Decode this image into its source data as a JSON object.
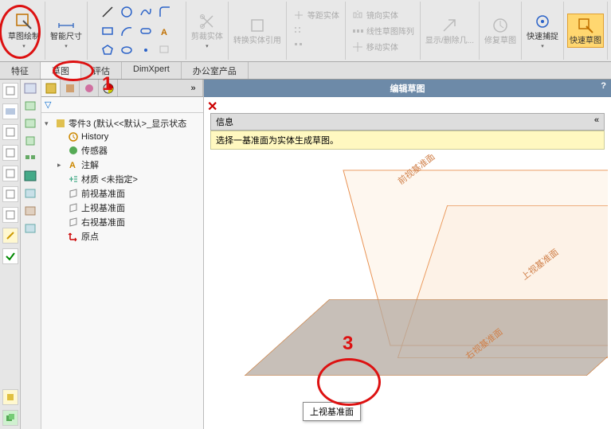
{
  "ribbon": {
    "sketch": {
      "label": "草图绘制"
    },
    "smartdim": {
      "label": "智能尺寸"
    },
    "trim": {
      "label": "剪裁实体"
    },
    "convert": {
      "label": "转换实体引用"
    },
    "equidist": {
      "label": "等距实体"
    },
    "mirror": {
      "label": "镜向实体"
    },
    "linpattern": {
      "label": "线性草图阵列"
    },
    "moveent": {
      "label": "移动实体"
    },
    "showdel": {
      "label": "显示/删除几..."
    },
    "repair": {
      "label": "修复草图"
    },
    "quicksnap": {
      "label": "快速捕捉"
    },
    "quicksketch": {
      "label": "快速草图"
    }
  },
  "tabs": {
    "features": "特征",
    "sketch": "草图",
    "evaluate": "评估",
    "dimxpert": "DimXpert",
    "office": "办公室产品"
  },
  "tree": {
    "root": "零件3  (默认<<默认>_显示状态",
    "history": "History",
    "sensors": "传感器",
    "annotations": "注解",
    "material": "材质 <未指定>",
    "frontplane": "前视基准面",
    "topplane": "上视基准面",
    "rightplane": "右视基准面",
    "origin": "原点"
  },
  "viewport": {
    "title": "编辑草图",
    "info_header": "信息",
    "info_body": "选择一基准面为实体生成草图。",
    "help": "?",
    "close": "✕",
    "collapse": "«"
  },
  "planes": {
    "front_label": "前视基准面",
    "top_label": "上视基准面",
    "right_label": "右视基准面"
  },
  "tooltip": {
    "topplane": "上视基准面"
  },
  "annotations": {
    "n1": "1",
    "n3": "3"
  }
}
